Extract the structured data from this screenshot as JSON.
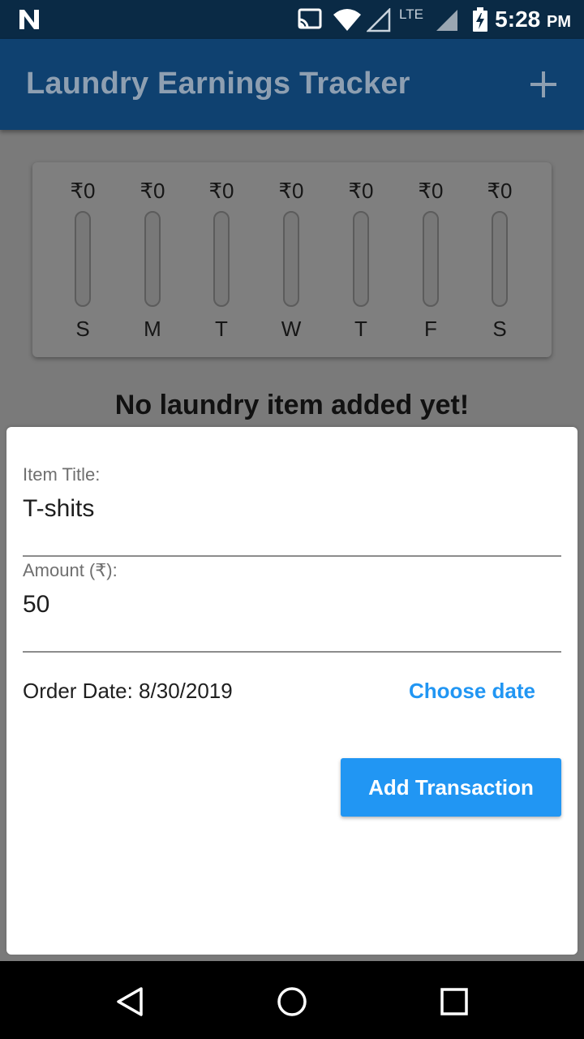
{
  "status_bar": {
    "network_label": "LTE",
    "time": "5:28",
    "ampm": "PM",
    "icons": [
      "notification-n-icon",
      "cast-icon",
      "wifi-icon",
      "signal-icon",
      "signal-icon",
      "battery-charging-icon"
    ]
  },
  "app_bar": {
    "title": "Laundry Earnings Tracker",
    "add_icon": "plus-icon"
  },
  "weekly_chart": {
    "days": [
      {
        "label": "S",
        "amount": "₹0",
        "fraction": 0
      },
      {
        "label": "M",
        "amount": "₹0",
        "fraction": 0
      },
      {
        "label": "T",
        "amount": "₹0",
        "fraction": 0
      },
      {
        "label": "W",
        "amount": "₹0",
        "fraction": 0
      },
      {
        "label": "T",
        "amount": "₹0",
        "fraction": 0
      },
      {
        "label": "F",
        "amount": "₹0",
        "fraction": 0
      },
      {
        "label": "S",
        "amount": "₹0",
        "fraction": 0
      }
    ]
  },
  "empty_message": "No laundry item added yet!",
  "form": {
    "title_label": "Item Title:",
    "title_value": "T-shits",
    "amount_label": "Amount (₹):",
    "amount_value": "50",
    "order_date_text": "Order Date: 8/30/2019",
    "choose_date_label": "Choose date",
    "submit_label": "Add Transaction"
  },
  "nav_bar": {
    "icons": [
      "back-icon",
      "home-icon",
      "recents-icon"
    ]
  },
  "colors": {
    "status_bar": "#0a2a45",
    "app_bar": "#0f4170",
    "accent": "#2196f3",
    "scrim_bg": "#7a7a7a"
  }
}
